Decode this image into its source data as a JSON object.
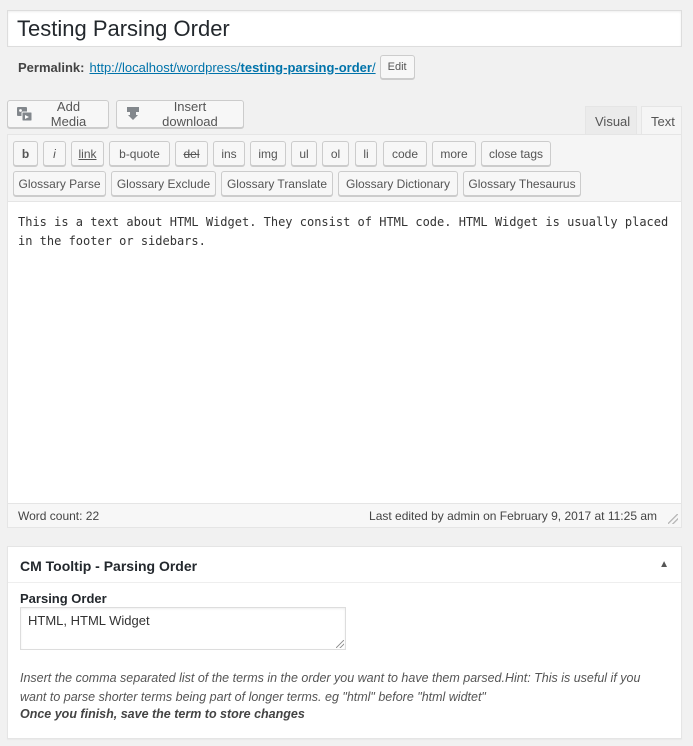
{
  "post": {
    "title": "Testing Parsing Order",
    "permalink_label": "Permalink:",
    "permalink_base": "http://localhost/wordpress/",
    "permalink_slug": "testing-parsing-order",
    "permalink_trailing": "/",
    "edit_label": "Edit"
  },
  "media_buttons": {
    "add_media": "Add Media",
    "insert_download": "Insert download"
  },
  "tabs": {
    "visual": "Visual",
    "text": "Text",
    "active": "Text"
  },
  "quicktags": {
    "row1": [
      "b",
      "i",
      "link",
      "b-quote",
      "del",
      "ins",
      "img",
      "ul",
      "ol",
      "li",
      "code",
      "more",
      "close tags"
    ],
    "row2": [
      "Glossary Parse",
      "Glossary Exclude",
      "Glossary Translate",
      "Glossary Dictionary",
      "Glossary Thesaurus"
    ]
  },
  "editor": {
    "content": "This is a text about HTML Widget. They consist of HTML code. HTML Widget is usually placed in the footer or sidebars.",
    "word_count": "Word count: 22",
    "last_edited": "Last edited by admin on February 9, 2017 at 11:25 am"
  },
  "metabox": {
    "title": "CM Tooltip - Parsing Order",
    "toggle_icon": "triangle-up",
    "field_label": "Parsing Order",
    "field_value": "HTML, HTML Widget",
    "hint": "Insert the comma separated list of the terms in the order you want to have them parsed.Hint: This is useful if you want to parse shorter terms being part of longer terms. eg \"html\" before \"html widtet\"",
    "note": "Once you finish, save the term to store changes"
  },
  "colors": {
    "link": "#0073aa",
    "background": "#f1f1f1",
    "border": "#e5e5e5"
  }
}
